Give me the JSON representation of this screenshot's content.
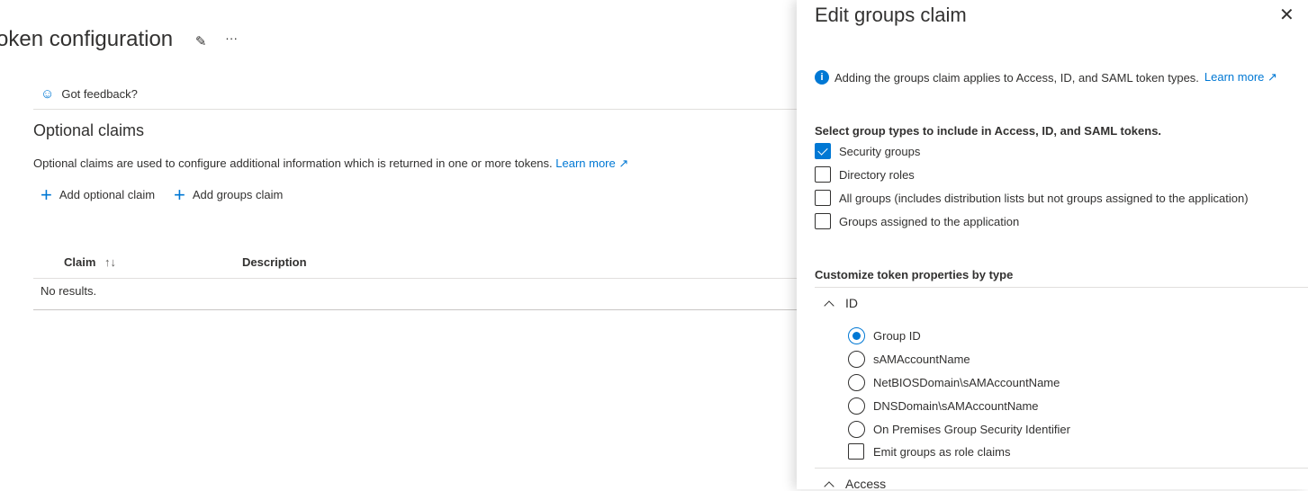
{
  "page": {
    "title": "oken configuration",
    "pin_icon": "pin-icon",
    "more_label": "···"
  },
  "toolbar": {
    "feedback_label": "Got feedback?"
  },
  "optional_claims": {
    "heading": "Optional claims",
    "description": "Optional claims are used to configure additional information which is returned in one or more tokens.",
    "learn_more": "Learn more",
    "add_optional_claim": "Add optional claim",
    "add_groups_claim": "Add groups claim",
    "table": {
      "columns": [
        "Claim",
        "Description"
      ],
      "sort_indicator": "↑↓",
      "empty": "No results."
    }
  },
  "panel": {
    "title": "Edit groups claim",
    "info_text": "Adding the groups claim applies to Access, ID, and SAML token types.",
    "learn_more": "Learn more",
    "group_types_label": "Select group types to include in Access, ID, and SAML tokens.",
    "group_types": [
      {
        "label": "Security groups",
        "checked": true
      },
      {
        "label": "Directory roles",
        "checked": false
      },
      {
        "label": "All groups (includes distribution lists but not groups assigned to the application)",
        "checked": false
      },
      {
        "label": "Groups assigned to the application",
        "checked": false
      }
    ],
    "customize_label": "Customize token properties by type",
    "sections": [
      {
        "name": "ID",
        "expanded": true,
        "options": [
          {
            "label": "Group ID",
            "selected": true
          },
          {
            "label": "sAMAccountName",
            "selected": false
          },
          {
            "label": "NetBIOSDomain\\sAMAccountName",
            "selected": false
          },
          {
            "label": "DNSDomain\\sAMAccountName",
            "selected": false
          },
          {
            "label": "On Premises Group Security Identifier",
            "selected": false
          }
        ],
        "emit_roles": {
          "label": "Emit groups as role claims",
          "checked": false
        }
      },
      {
        "name": "Access",
        "expanded": true
      }
    ]
  },
  "colors": {
    "accent": "#0078d4",
    "text": "#323130"
  }
}
